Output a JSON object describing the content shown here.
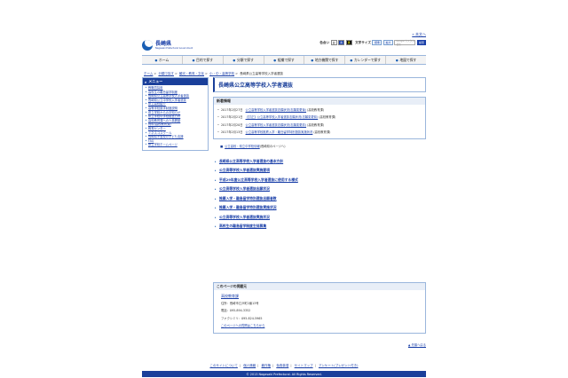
{
  "header": {
    "skip_link": "» 本文へ",
    "logo_jp": "長崎県",
    "logo_en": "Nagasaki Prefectural Government",
    "color_label": "色合い",
    "colors": [
      "白",
      "青",
      "黒"
    ],
    "fontsize_label": "文字サイズ",
    "font_buttons": [
      "標準",
      "拡大"
    ],
    "search_placeholder": "Google カスタム検索",
    "search_button": "検索"
  },
  "gnav": [
    {
      "label": "ホーム",
      "icon": "circle-arrow-icon"
    },
    {
      "label": "目的で探す",
      "icon": "circle-arrow-icon"
    },
    {
      "label": "分類で探す",
      "icon": "circle-arrow-icon"
    },
    {
      "label": "組織で探す",
      "icon": "circle-arrow-icon"
    },
    {
      "label": "地方機関で探す",
      "icon": "circle-arrow-icon"
    },
    {
      "label": "カレンダーで探す",
      "icon": "circle-arrow-icon"
    },
    {
      "label": "地図で探す",
      "icon": "circle-arrow-icon"
    }
  ],
  "breadcrumb": [
    "ホーム",
    "分類で探す",
    "観光・教育・文化",
    "小・中・高等学校",
    "長崎県公立高等学校入学者選抜"
  ],
  "sidebar": {
    "title": "メニュー",
    "items": [
      "教職員採用",
      "高校生の離島留学制度",
      "長崎県公立高等学校入学者選抜",
      "長崎県公立中学校入学者選抜",
      "県立高校紹介",
      "高等学校奨学制度説明",
      "県立学校からのお知らせ",
      "県立学校の学校経営方針",
      "高校教育課への人事異動",
      "資料(高校教育課)",
      "教育センター",
      "ミネスコスクール",
      "長崎県不登校の子ども支援",
      "FAQ",
      "県立学校ホームページ"
    ]
  },
  "main": {
    "title": "長崎県公立高等学校入学者選抜",
    "news_title": "新着情報",
    "news": [
      {
        "date": "2017年2月27日",
        "text": "公立高等学校入学者選抜志願状況(志願変更後)",
        "suffix": "(高校教育課)"
      },
      {
        "date": "2017年2月21日",
        "text": "【訂正】公立高等学校入学者選抜志願状況(志願変更前)",
        "suffix": "(高校教育課)"
      },
      {
        "date": "2017年2月20日",
        "text": "公立高等学校入学者選抜志願状況(志願変更前)",
        "suffix": "(高校教育課)"
      },
      {
        "date": "2017年2月13日",
        "text": "公立高等学校推薦入学・離島留学特別選抜実施状況",
        "suffix": "(高校教育課)"
      }
    ],
    "pdf_link": "公立高校・県立中学校情報",
    "pdf_note": "(長崎県のページへ)",
    "topics": [
      "長崎県公立高等学校入学者選抜の基本方針",
      "公立高等学校入学者選抜実施要項",
      "平成29年度公立高等学校入学者選抜に使用する様式",
      "公立高等学校入学者選抜志願状況",
      "推薦入学・離島留学特別選抜志願者数",
      "推薦入学・離島留学特別選抜実施状況",
      "公立高等学校入学者選抜実施状況",
      "高校生の離島留学制度生徒募集"
    ]
  },
  "contact": {
    "title": "このページの掲載元",
    "department": "高校教育課",
    "address": "住所：長崎市江戸町2番13号",
    "phone": "電話：095-894-3352",
    "fax": "ファクシミリ：095-824-5965",
    "inquiry": "このページへの質問はこちらから"
  },
  "pagetop": "▲ 先頭へ戻る",
  "footer": {
    "links": [
      "このサイトについて",
      "個人情報",
      "著作権",
      "免責事項",
      "サイトマップ",
      "アンケート(プレゼント付き)"
    ],
    "copyright": "© 2013 Nagasaki Prefectural. All Rights Reserved."
  }
}
